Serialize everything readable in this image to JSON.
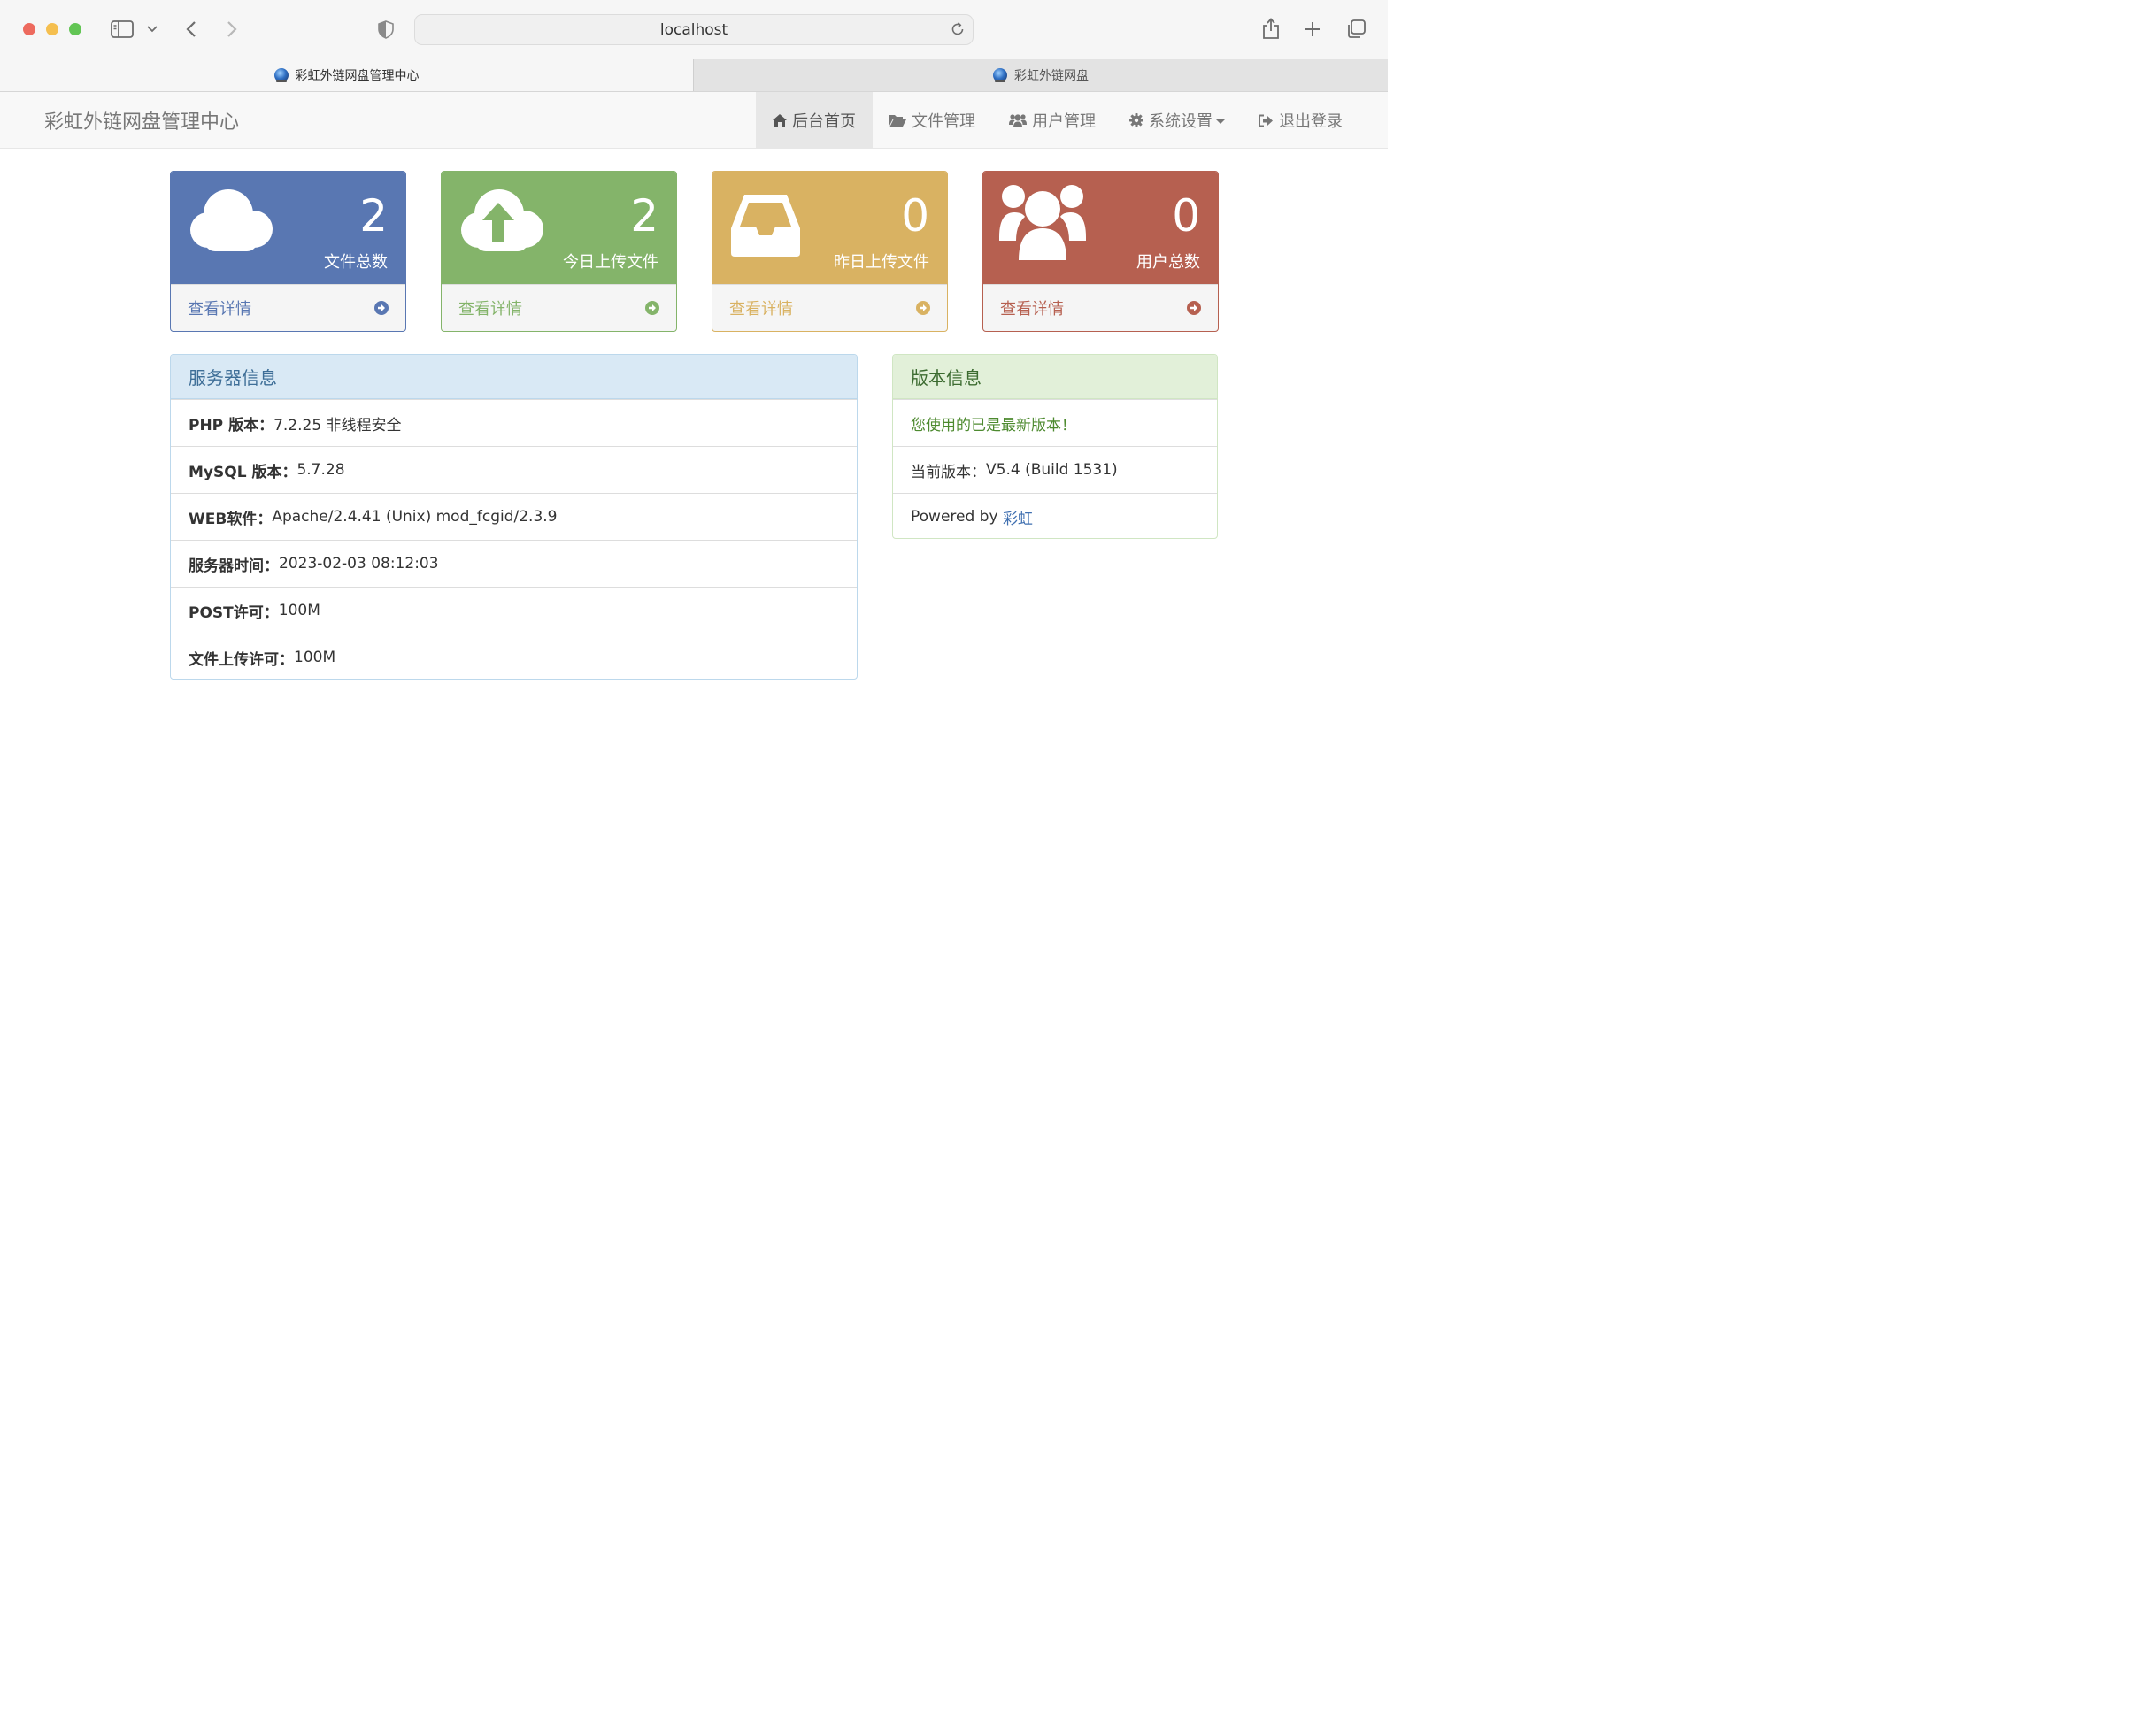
{
  "browser": {
    "address": "localhost",
    "tabs": [
      {
        "label": "彩虹外链网盘管理中心"
      },
      {
        "label": "彩虹外链网盘"
      }
    ]
  },
  "navbar": {
    "brand": "彩虹外链网盘管理中心",
    "items": [
      {
        "label": "后台首页",
        "icon": "home-icon"
      },
      {
        "label": "文件管理",
        "icon": "folder-open-icon"
      },
      {
        "label": "用户管理",
        "icon": "users-icon"
      },
      {
        "label": "系统设置",
        "icon": "gear-icon"
      },
      {
        "label": "退出登录",
        "icon": "sign-out-icon"
      }
    ]
  },
  "stats": [
    {
      "value": "2",
      "label": "文件总数",
      "link": "查看详情",
      "color": "#5977b2",
      "icon": "cloud-icon"
    },
    {
      "value": "2",
      "label": "今日上传文件",
      "link": "查看详情",
      "color": "#84b46a",
      "icon": "cloud-upload-icon"
    },
    {
      "value": "0",
      "label": "昨日上传文件",
      "link": "查看详情",
      "color": "#d9b262",
      "icon": "inbox-icon"
    },
    {
      "value": "0",
      "label": "用户总数",
      "link": "查看详情",
      "color": "#b66050",
      "icon": "users-icon"
    }
  ],
  "server_panel": {
    "title": "服务器信息",
    "rows": [
      {
        "key": "PHP 版本：",
        "value": "7.2.25 非线程安全"
      },
      {
        "key": "MySQL 版本：",
        "value": "5.7.28"
      },
      {
        "key": "WEB软件：",
        "value": "Apache/2.4.41 (Unix) mod_fcgid/2.3.9"
      },
      {
        "key": "服务器时间：",
        "value": "2023-02-03 08:12:03"
      },
      {
        "key": "POST许可：",
        "value": "100M"
      },
      {
        "key": "文件上传许可：",
        "value": "100M"
      }
    ]
  },
  "version_panel": {
    "title": "版本信息",
    "latest": "您使用的已是最新版本！",
    "current_label": "当前版本：",
    "current_value": "V5.4 (Build 1531)",
    "powered_label": "Powered by ",
    "powered_link": "彩虹"
  }
}
